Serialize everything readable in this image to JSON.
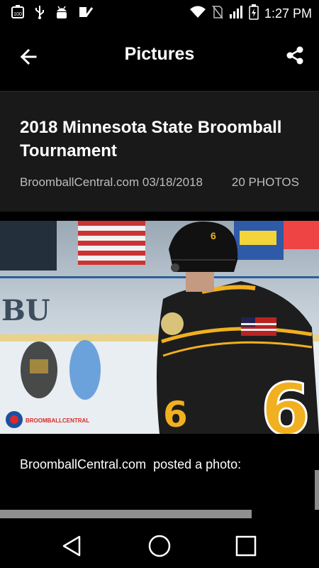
{
  "status_bar": {
    "time": "1:27 PM",
    "battery_level_text": "100",
    "icons": [
      "battery-100-icon",
      "usb-icon",
      "android-debug-icon",
      "task-check-icon",
      "wifi-icon",
      "no-sim-icon",
      "signal-icon",
      "battery-charging-icon"
    ]
  },
  "app_bar": {
    "title": "Pictures",
    "back_icon": "arrow-left-icon",
    "share_icon": "share-icon"
  },
  "album": {
    "title": "2018 Minnesota State Broomball Tournament",
    "source_and_date": "BroomballCentral.com 03/18/2018",
    "photo_count": "20 PHOTOS"
  },
  "photo": {
    "description": "Broomball player number 6 in black and gold jersey on ice rink",
    "logo_text": "BROOMBALLCENTRAL",
    "jersey_number": "6",
    "helmet_number": "6",
    "banner_text": "BU"
  },
  "post": {
    "text": "BroomballCentral.com  posted a photo:"
  },
  "nav_bar": {
    "buttons": [
      "back-triangle-icon",
      "home-circle-icon",
      "recents-square-icon"
    ]
  },
  "colors": {
    "background": "#000000",
    "header_panel": "#191919",
    "meta_text": "#bdbdbd",
    "jersey_gold": "#f0b020"
  }
}
